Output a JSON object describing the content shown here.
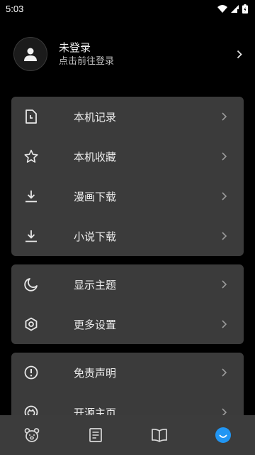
{
  "status_bar": {
    "time": "5:03"
  },
  "profile": {
    "name": "未登录",
    "subtitle": "点击前往登录",
    "icon": "person-icon"
  },
  "menu_group_1": [
    {
      "label": "本机记录",
      "icon": "history-file-icon"
    },
    {
      "label": "本机收藏",
      "icon": "star-icon"
    },
    {
      "label": "漫画下载",
      "icon": "download-icon"
    },
    {
      "label": "小说下载",
      "icon": "download-icon"
    }
  ],
  "menu_group_2": [
    {
      "label": "显示主题",
      "icon": "moon-icon"
    },
    {
      "label": "更多设置",
      "icon": "settings-hexagon-icon"
    }
  ],
  "menu_group_3": [
    {
      "label": "免责声明",
      "icon": "alert-circle-icon"
    },
    {
      "label": "开源主页",
      "icon": "github-icon"
    }
  ],
  "bottom_nav": [
    {
      "name": "bear-icon",
      "active": false
    },
    {
      "name": "article-icon",
      "active": false
    },
    {
      "name": "book-icon",
      "active": false
    },
    {
      "name": "smile-icon",
      "active": true
    }
  ],
  "colors": {
    "accent": "#2196f3",
    "card": "#3b3b3b",
    "nav": "#3c3c3c"
  }
}
